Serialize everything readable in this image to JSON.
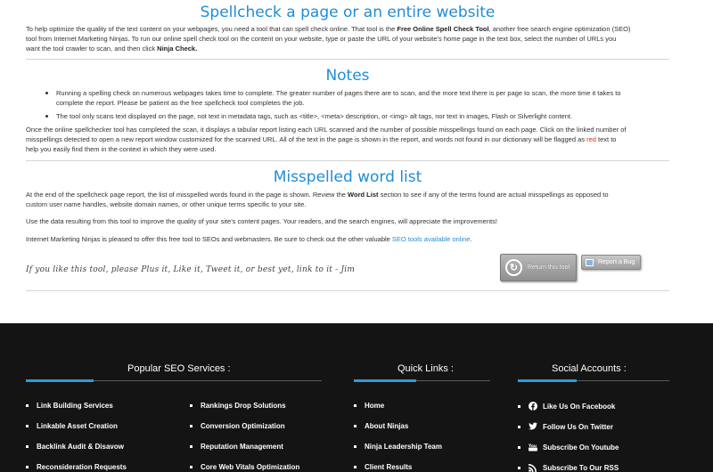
{
  "main": {
    "title": "Spellcheck a page or an entire website",
    "intro_1": "To help optimize the quality of the text content on your webpages, you need a tool that can spell check online. That tool is the ",
    "intro_bold_1": "Free Online Spell Check Tool",
    "intro_2": ", another free search engine optimization (SEO)",
    "intro_3": "tool from Internet Marketing Ninjas. To run our online spell check tool on the content on your website, type or paste the URL of your website’s home page in the text box, select the number of URLs you",
    "intro_4": "want the tool crawler to scan, and then click ",
    "intro_bold_2": "Ninja Check.",
    "notes_title": "Notes",
    "note_1a": "Running a spelling check on numerous webpages takes time to complete. The greater number of pages there are to scan, and the more text there is per page to scan, the more time it takes to",
    "note_1b": "complete the report. Please be patient as the free spellcheck tool completes the job.",
    "note_2": "The tool only scans text displayed on the page, not text in metadata tags, such as <title>, <meta> description, or <img> alt tags, nor text in images, Flash or Silverlight content.",
    "para_1a": "Once the online spellchecker tool has completed the scan, it displays a tabular report listing each URL scanned and the number of possible misspellings found on each page. Click on the linked number of",
    "para_1b": "misspellings detected to open a new report window customized for the scanned URL. All of the text in the page is shown in the report, and words not found in our dictionary will be flagged as ",
    "para_1_red": "red",
    "para_1c": " text to",
    "para_1d": "help you easily find them in the context in which they were used.",
    "misspelled_title": "Misspelled word list",
    "para_2a": "At the end of the spellcheck page report, the list of misspelled words found in the page is shown. Review the ",
    "para_2_bold": "Word List",
    "para_2b": " section to see if any of the terms found are actual misspellings as opposed to",
    "para_2c": "custom user name handles, website domain names, or other unique terms specific to your site.",
    "para_3": "Use the data resulting from this tool to improve the quality of your site’s content pages. Your readers, and the search engines, will appreciate the improvements!",
    "para_4": "Internet Marketing Ninjas is pleased to offer this free tool to SEOs and webmasters. Be sure to check out the other valuable ",
    "para_4_link": "SEO tools available online",
    "para_4_end": ".",
    "thanks": "If you like this tool, please Plus it, Like it, Tweet it, or best yet, link to it - Jim",
    "return_label": "Return this tool",
    "bug_label": "Report a Bug"
  },
  "footer": {
    "popular_title": "Popular SEO Services :",
    "popular_col1": [
      "Link Building Services",
      "Linkable Asset Creation",
      "Backlink Audit & Disavow",
      "Reconsideration Requests"
    ],
    "popular_col2": [
      "Rankings Drop Solutions",
      "Conversion Optimization",
      "Reputation Management",
      "Core Web Vitals Optimization"
    ],
    "quick_title": "Quick Links :",
    "quick_links": [
      "Home",
      "About Ninjas",
      "Ninja Leadership Team",
      "Client Results"
    ],
    "social_title": "Social Accounts :",
    "social": [
      "Like Us On Facebook",
      "Follow Us On Twitter",
      "Subscribe On Youtube",
      "Subscribe To Our RSS"
    ],
    "accent_color": "#2f9ad8"
  }
}
